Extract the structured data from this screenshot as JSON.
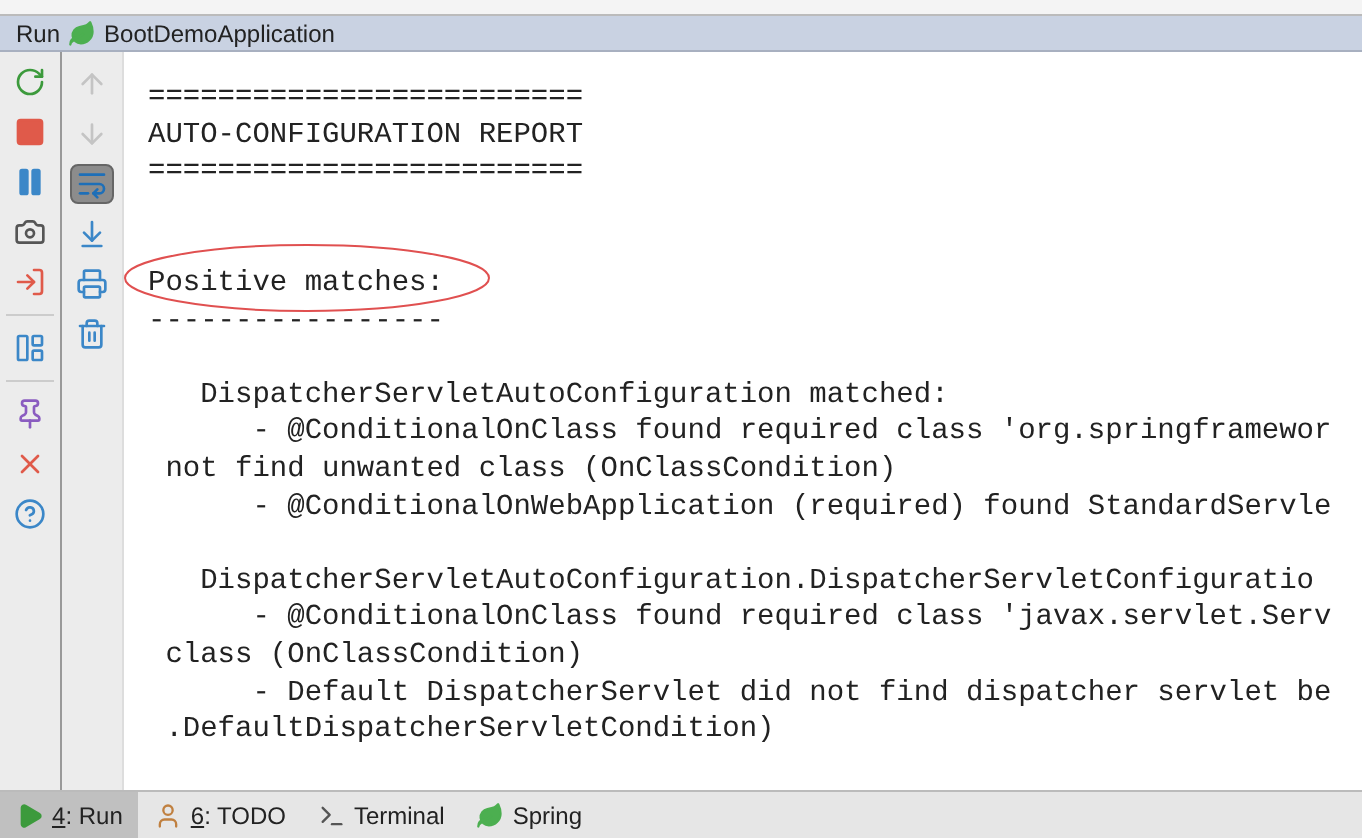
{
  "panel": {
    "title": "Run",
    "config": "BootDemoApplication"
  },
  "console": {
    "blocks": [
      {
        "kind": "banner",
        "lines": [
          {
            "text": "=========================",
            "circled": false
          },
          {
            "text": "AUTO-CONFIGURATION REPORT",
            "circled": false
          },
          {
            "text": "=========================",
            "circled": false
          }
        ]
      },
      {
        "kind": "heading",
        "lines": [
          {
            "text": "Positive matches:",
            "circled": true
          },
          {
            "text": "-----------------",
            "circled": false
          }
        ]
      },
      {
        "kind": "entry",
        "lines": [
          {
            "text": "   DispatcherServletAutoConfiguration matched:",
            "circled": false
          },
          {
            "text": "      - @ConditionalOnClass found required class 'org.springframewor",
            "circled": false
          },
          {
            "text": " not find unwanted class (OnClassCondition)",
            "circled": false
          },
          {
            "text": "      - @ConditionalOnWebApplication (required) found StandardServle",
            "circled": false
          }
        ]
      },
      {
        "kind": "entry",
        "lines": [
          {
            "text": "   DispatcherServletAutoConfiguration.DispatcherServletConfiguratio",
            "circled": false
          },
          {
            "text": "      - @ConditionalOnClass found required class 'javax.servlet.Serv",
            "circled": false
          },
          {
            "text": " class (OnClassCondition)",
            "circled": false
          },
          {
            "text": "      - Default DispatcherServlet did not find dispatcher servlet be",
            "circled": false
          },
          {
            "text": " .DefaultDispatcherServletCondition)",
            "circled": false
          }
        ]
      }
    ]
  },
  "toolbar_left": [
    {
      "kind": "rerun"
    },
    {
      "kind": "stop"
    },
    {
      "kind": "pause"
    },
    {
      "kind": "camera"
    },
    {
      "kind": "exit"
    },
    {
      "kind": "sep"
    },
    {
      "kind": "layout"
    },
    {
      "kind": "sep"
    },
    {
      "kind": "pin"
    },
    {
      "kind": "close"
    },
    {
      "kind": "help"
    }
  ],
  "toolbar_right": [
    {
      "kind": "up",
      "disabled": true,
      "selected": false
    },
    {
      "kind": "down",
      "disabled": true,
      "selected": false
    },
    {
      "kind": "wrap",
      "disabled": false,
      "selected": true
    },
    {
      "kind": "scroll",
      "disabled": false,
      "selected": false
    },
    {
      "kind": "print",
      "disabled": false,
      "selected": false
    },
    {
      "kind": "trash",
      "disabled": false,
      "selected": false
    }
  ],
  "tabs": [
    {
      "label": "4: Run",
      "kind": "run",
      "selected": true
    },
    {
      "label": "6: TODO",
      "kind": "todo",
      "selected": false
    },
    {
      "label": "Terminal",
      "kind": "terminal",
      "selected": false
    },
    {
      "label": "Spring",
      "kind": "spring",
      "selected": false
    }
  ]
}
